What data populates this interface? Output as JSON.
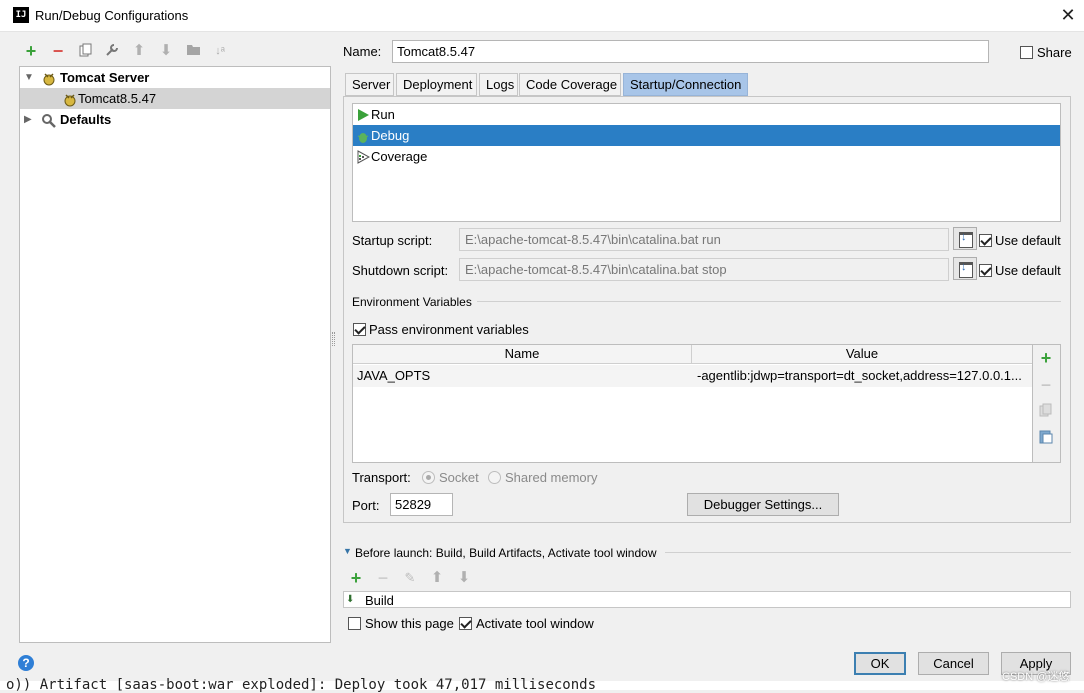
{
  "window": {
    "title": "Run/Debug Configurations",
    "app_icon": "IJ"
  },
  "toolbar": {
    "icons": [
      "add-icon",
      "remove-icon",
      "copy-icon",
      "wrench-icon",
      "move-up-icon",
      "move-down-icon",
      "folder-icon",
      "sort-icon"
    ]
  },
  "tree": {
    "items": [
      {
        "label": "Tomcat Server",
        "icon": "tomcat-icon",
        "expanded": true
      },
      {
        "label": "Tomcat8.5.47",
        "icon": "tomcat-icon",
        "selected": true
      },
      {
        "label": "Defaults",
        "icon": "wrench-icon",
        "expanded": false
      }
    ]
  },
  "config": {
    "name_label": "Name:",
    "name_value": "Tomcat8.5.47",
    "share_label": "Share",
    "share_checked": false
  },
  "tabs": [
    {
      "label": "Server"
    },
    {
      "label": "Deployment"
    },
    {
      "label": "Logs"
    },
    {
      "label": "Code Coverage"
    },
    {
      "label": "Startup/Connection",
      "active": true
    }
  ],
  "modes": [
    {
      "label": "Run",
      "icon": "run-icon"
    },
    {
      "label": "Debug",
      "icon": "debug-icon",
      "selected": true
    },
    {
      "label": "Coverage",
      "icon": "coverage-icon"
    }
  ],
  "scripts": {
    "startup_label": "Startup script:",
    "startup_value": "E:\\apache-tomcat-8.5.47\\bin\\catalina.bat run",
    "shutdown_label": "Shutdown script:",
    "shutdown_value": "E:\\apache-tomcat-8.5.47\\bin\\catalina.bat stop",
    "use_default_label": "Use default"
  },
  "env": {
    "section_title": "Environment Variables",
    "pass_label": "Pass environment variables",
    "pass_checked": true,
    "columns": [
      "Name",
      "Value"
    ],
    "rows": [
      {
        "name": "JAVA_OPTS",
        "value": "-agentlib:jdwp=transport=dt_socket,address=127.0.0.1..."
      }
    ]
  },
  "transport": {
    "label": "Transport:",
    "socket_label": "Socket",
    "shared_label": "Shared memory",
    "selected": "Socket"
  },
  "port": {
    "label": "Port:",
    "value": "52829",
    "debugger_settings_label": "Debugger Settings..."
  },
  "before_launch": {
    "title": "Before launch: Build, Build Artifacts, Activate tool window",
    "items": [
      {
        "label": "Build",
        "icon": "build-icon"
      }
    ],
    "show_page_label": "Show this page",
    "show_page_checked": false,
    "activate_label": "Activate tool window",
    "activate_checked": true
  },
  "buttons": {
    "ok": "OK",
    "cancel": "Cancel",
    "apply": "Apply"
  },
  "background": {
    "console_text": "o)) Artifact [saas-boot:war exploded]: Deploy took 47,017 milliseconds",
    "watermark": "CSDN @迷悠"
  },
  "colors": {
    "selection": "#2a7ec5",
    "active_tab": "#a8c5e8",
    "add_green": "#3aa13a",
    "remove_red": "#d9534f"
  }
}
